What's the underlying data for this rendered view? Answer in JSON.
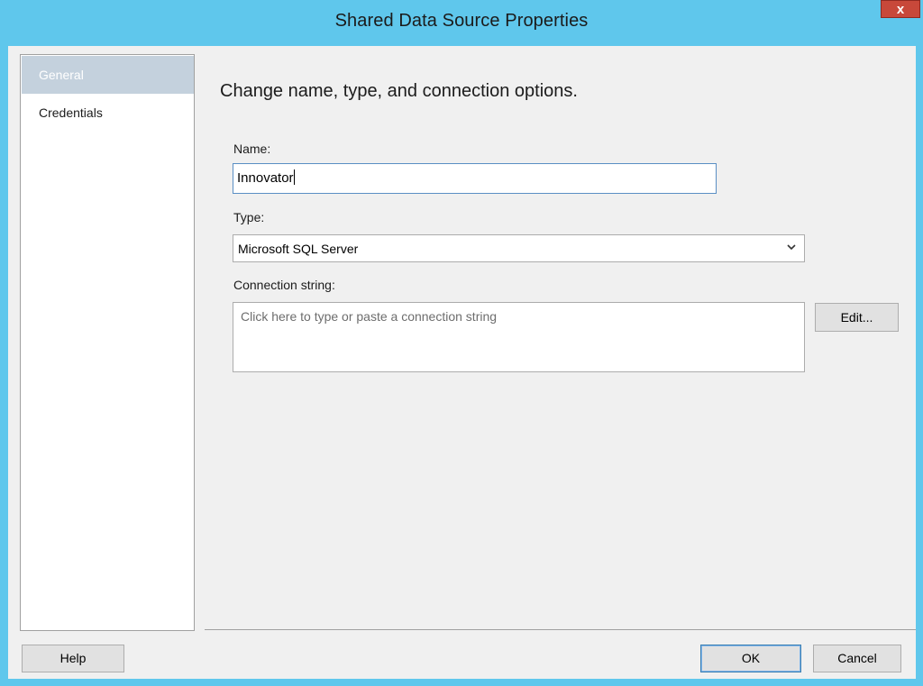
{
  "window": {
    "title": "Shared Data Source Properties",
    "close_label": "x"
  },
  "nav": {
    "items": [
      {
        "label": "General",
        "selected": true
      },
      {
        "label": "Credentials",
        "selected": false
      }
    ]
  },
  "main": {
    "heading": "Change name, type, and connection options.",
    "name_label": "Name:",
    "name_value": "Innovator",
    "type_label": "Type:",
    "type_value": "Microsoft SQL Server",
    "connection_label": "Connection string:",
    "connection_placeholder": "Click here to type or paste a connection string",
    "edit_button": "Edit..."
  },
  "footer": {
    "help_button": "Help",
    "ok_button": "OK",
    "cancel_button": "Cancel"
  },
  "colors": {
    "frame": "#5fc7ec",
    "close": "#c8483a",
    "nav_selected": "#c4d1dd"
  },
  "icons": {
    "dropdown": "chevron-down-icon"
  }
}
